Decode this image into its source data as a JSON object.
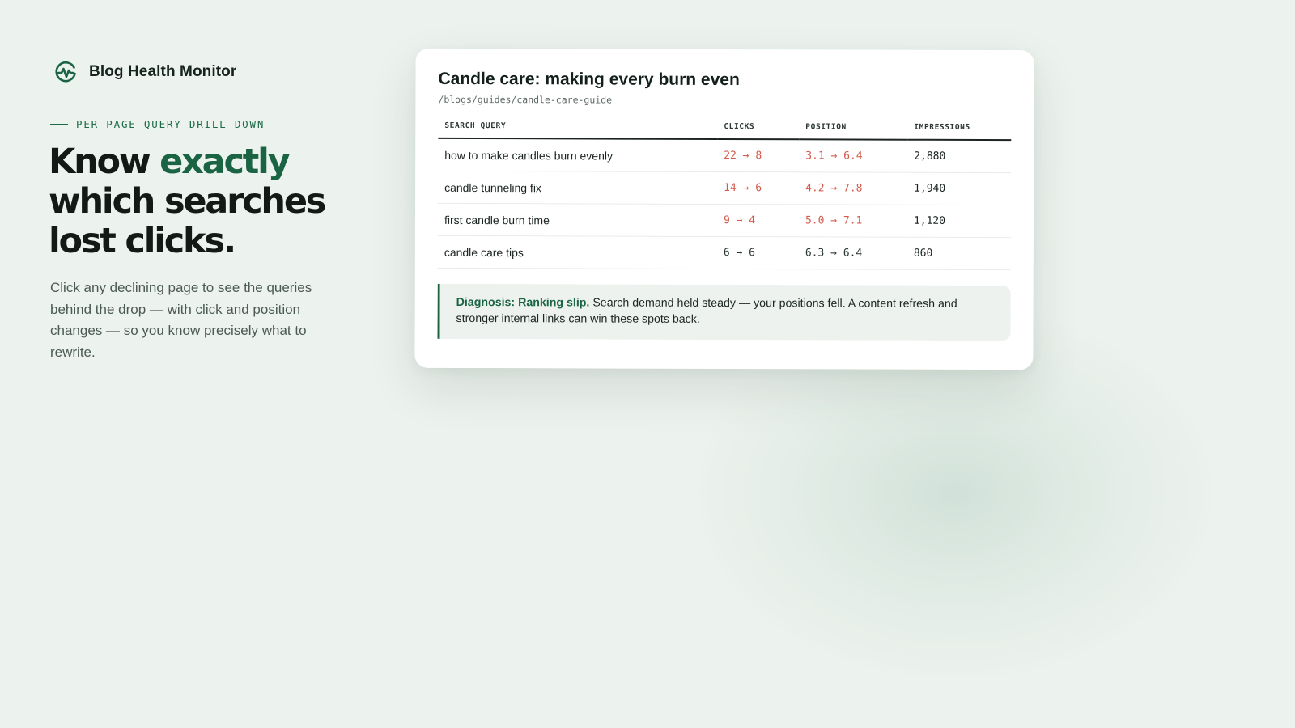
{
  "brand": {
    "name": "Blog Health Monitor",
    "icon": "pulse-wave-icon",
    "accent_color": "#1a6444"
  },
  "hero": {
    "eyebrow": "PER-PAGE QUERY DRILL-DOWN",
    "headline_pre": "Know ",
    "headline_accent": "exactly",
    "headline_post": " which searches lost clicks.",
    "lede": "Click any declining page to see the queries behind the drop — with click and position changes — so you know precisely what to rewrite."
  },
  "card": {
    "title": "Candle care: making every burn even",
    "path": "/blogs/guides/candle-care-guide",
    "columns": [
      "SEARCH QUERY",
      "CLICKS",
      "POSITION",
      "IMPRESSIONS"
    ],
    "rows": [
      {
        "query": "how to make candles burn evenly",
        "clicks": "22 → 8",
        "position": "3.1 → 6.4",
        "impressions": "2,880",
        "trend": "down"
      },
      {
        "query": "candle tunneling fix",
        "clicks": "14 → 6",
        "position": "4.2 → 7.8",
        "impressions": "1,940",
        "trend": "down"
      },
      {
        "query": "first candle burn time",
        "clicks": "9 → 4",
        "position": "5.0 → 7.1",
        "impressions": "1,120",
        "trend": "down"
      },
      {
        "query": "candle care tips",
        "clicks": "6 → 6",
        "position": "6.3 → 6.4",
        "impressions": "860",
        "trend": "flat"
      }
    ],
    "diagnosis": {
      "label": "Diagnosis: Ranking slip.",
      "text": "Search demand held steady — your positions fell. A content refresh and stronger internal links can win these spots back."
    },
    "colors": {
      "decline": "#d45a4c",
      "neutral": "#2a3530"
    }
  }
}
